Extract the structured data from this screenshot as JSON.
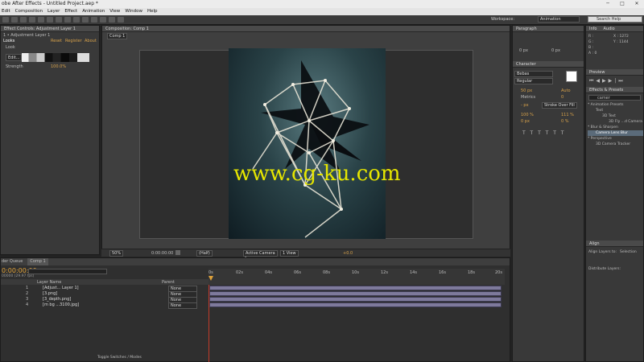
{
  "app": {
    "title": "Adobe After Effects - Untitled Project.aep *",
    "title_visible": "obe After Effects - Untitled Project.aep *"
  },
  "menu": [
    "Edit",
    "Composition",
    "Layer",
    "Effect",
    "Animation",
    "View",
    "Window",
    "Help"
  ],
  "toolbar": {
    "workspace_label": "Workspace:",
    "workspace_value": "Animation",
    "search_placeholder": "Search Help"
  },
  "effect_controls": {
    "tab": "Effect Controls: Adjustment Layer 1",
    "breadcrumb": "1 • Adjustment Layer 1",
    "looks_label": "Looks",
    "reset": "Reset",
    "register": "Register",
    "about": "About",
    "look_label": "Look",
    "edit_btn": "Edit...",
    "strength_label": "Strength",
    "strength_value": "100.0%"
  },
  "comp_panel": {
    "tab": "Composition: Comp 1",
    "subtab": "Comp 1",
    "watermark": "www.cg-ku.com",
    "zoom": "50%",
    "time": "0:00:00:00",
    "quality": "(Half)",
    "camera": "Active Camera",
    "views": "1 View",
    "offset": "+0.0"
  },
  "timeline": {
    "tabs": [
      "der Queue",
      "Comp 1"
    ],
    "time": "0:00:00:00",
    "fps": "00000 (29.97 fps)",
    "col_layer": "Layer Name",
    "col_parent": "Parent",
    "ruler": [
      "0s",
      "02s",
      "04s",
      "06s",
      "08s",
      "10s",
      "12s",
      "14s",
      "16s",
      "18s",
      "20s"
    ],
    "layers": [
      {
        "num": "1",
        "name": "[Adjust... Layer 1]",
        "parent": "None"
      },
      {
        "num": "2",
        "name": "[3.png]",
        "parent": "None"
      },
      {
        "num": "3",
        "name": "[3_depth.png]",
        "parent": "None"
      },
      {
        "num": "4",
        "name": "[m bg ...3100.jpg]",
        "parent": "None"
      }
    ],
    "toggle": "Toggle Switches / Modes"
  },
  "paragraph": {
    "tab": "Paragraph",
    "px": "0 px"
  },
  "character": {
    "tab": "Character",
    "font": "Bebas",
    "style": "Regular",
    "size": "50 px",
    "leading": "Auto",
    "kern": "Metrics",
    "track": "0",
    "stroke": "- px",
    "stroke_mode": "Stroke Over Fill",
    "vscale": "100 %",
    "hscale": "111 %",
    "baseline": "0 px",
    "tsume": "0 %"
  },
  "info": {
    "tabs": [
      "Info",
      "Audio"
    ],
    "r": "R :",
    "g": "G :",
    "b": "B :",
    "a": "A : 0",
    "x": "X : 1272",
    "y": "Y : 1144"
  },
  "preview": {
    "tab": "Preview"
  },
  "effects_presets": {
    "tab": "Effects & Presets",
    "search": "camer",
    "items": [
      "* Animation Presets",
      "Text",
      "3D Text",
      "3D Fly ...d Camera",
      "* Blur & Sharpen",
      "Camera Lens Blur",
      "* Perspective",
      "3D Camera Tracker"
    ]
  },
  "align": {
    "tab": "Align",
    "align_to": "Align Layers to:",
    "selection": "Selection",
    "distribute": "Distribute Layers:"
  }
}
